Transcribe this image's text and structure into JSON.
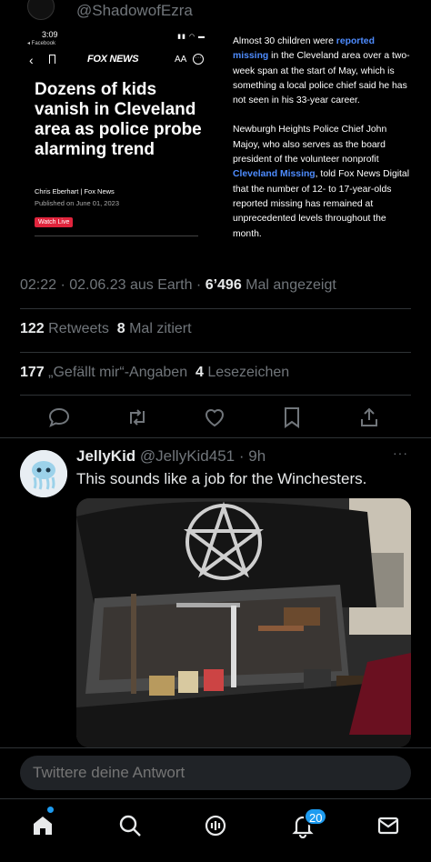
{
  "top_author": {
    "handle": "@ShadowofEzra"
  },
  "embed": {
    "phone": {
      "status_time": "3:09",
      "status_app": "◂ Facebook",
      "nav_logo": "FOX NEWS",
      "nav_aa": "AA",
      "headline": "Dozens of kids vanish in Cleveland area as police probe alarming trend",
      "byline": "Chris Eberhart | Fox News",
      "published": "Published on June 01, 2023",
      "watch_live": "Watch Live"
    },
    "article": {
      "p1_a": "Almost 30 children were ",
      "p1_link": "reported missing",
      "p1_b": " in the Cleveland area over a two-week span at the start of May, which is something a local police chief said he has not seen in his 33-year career.",
      "p2_a": "Newburgh Heights Police Chief John Majoy, who also serves as the board president of the volunteer nonprofit ",
      "p2_link": "Cleveland Missing",
      "p2_b": ", told Fox News Digital that the number of 12- to 17-year-olds reported missing has remained at unprecedented levels throughout the month."
    }
  },
  "meta": {
    "time": "02:22 · 02.06.23 aus Earth · ",
    "views": "6’496",
    "views_label": " Mal angezeigt"
  },
  "stats": {
    "retweets": "122",
    "retweets_label": " Retweets",
    "quotes": "8",
    "quotes_label": " Mal zitiert",
    "likes": "177",
    "likes_label": " „Gefällt mir“-Angaben",
    "bookmarks": "4",
    "bookmarks_label": " Lesezeichen"
  },
  "reply": {
    "name": "JellyKid",
    "handle": " @JellyKid451 · 9h",
    "text": "This sounds like a job for the Winchesters."
  },
  "composer": {
    "placeholder": "Twittere deine Antwort"
  },
  "nav": {
    "notification_count": "20"
  },
  "colors": {
    "accent": "#1d9bf0",
    "background": "#000000",
    "muted": "#71767b",
    "fox_link": "#4e8cff",
    "watch_live": "#e0243c"
  },
  "icons": [
    "reply-icon",
    "retweet-icon",
    "like-icon",
    "bookmark-icon",
    "share-icon",
    "home-icon",
    "search-icon",
    "spaces-icon",
    "notifications-icon",
    "messages-icon"
  ]
}
